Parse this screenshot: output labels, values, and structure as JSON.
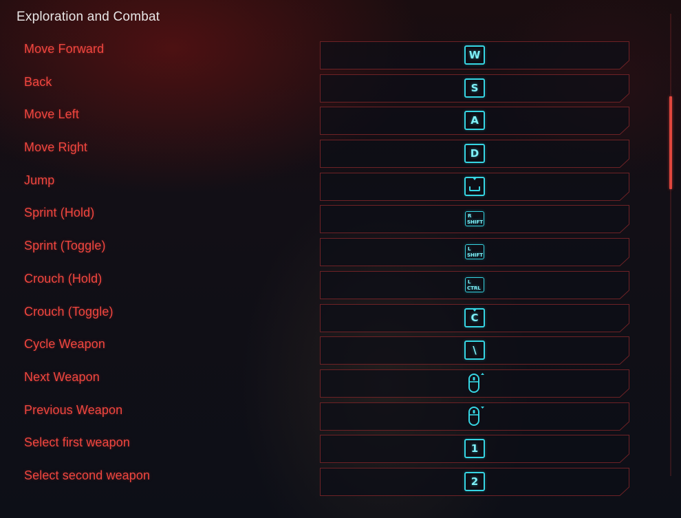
{
  "section_title": "Exploration and Combat",
  "colors": {
    "label_red": "#f0463f",
    "key_cyan": "#36d6e4",
    "frame_red": "#6e2226",
    "scroll_thumb": "#e0463d"
  },
  "bindings": [
    {
      "action": "Move Forward",
      "key": "W",
      "key_type": "letter",
      "icon": "w-key-icon"
    },
    {
      "action": "Back",
      "key": "S",
      "key_type": "letter",
      "icon": "s-key-icon"
    },
    {
      "action": "Move Left",
      "key": "A",
      "key_type": "letter",
      "icon": "a-key-icon"
    },
    {
      "action": "Move Right",
      "key": "D",
      "key_type": "letter",
      "icon": "d-key-icon"
    },
    {
      "action": "Jump",
      "key": "",
      "key_type": "space",
      "icon": "spacebar-key-icon"
    },
    {
      "action": "Sprint (Hold)",
      "key_top": "R",
      "key_bottom": "SHIFT",
      "key_type": "small",
      "icon": "right-shift-key-icon"
    },
    {
      "action": "Sprint (Toggle)",
      "key_top": "L",
      "key_bottom": "SHIFT",
      "key_type": "small",
      "icon": "left-shift-key-icon"
    },
    {
      "action": "Crouch (Hold)",
      "key_top": "L",
      "key_bottom": "CTRL",
      "key_type": "small",
      "icon": "left-ctrl-key-icon"
    },
    {
      "action": "Crouch (Toggle)",
      "key": "C",
      "key_type": "letter-notch",
      "icon": "c-key-icon"
    },
    {
      "action": "Cycle Weapon",
      "key": "\\",
      "key_type": "letter",
      "icon": "backslash-key-icon"
    },
    {
      "action": "Next Weapon",
      "key": "",
      "key_type": "mouse-up",
      "icon": "mouse-wheel-up-icon"
    },
    {
      "action": "Previous Weapon",
      "key": "",
      "key_type": "mouse-down",
      "icon": "mouse-wheel-down-icon"
    },
    {
      "action": "Select first weapon",
      "key": "1",
      "key_type": "letter",
      "icon": "one-key-icon"
    },
    {
      "action": "Select second weapon",
      "key": "2",
      "key_type": "letter",
      "icon": "two-key-icon"
    }
  ]
}
